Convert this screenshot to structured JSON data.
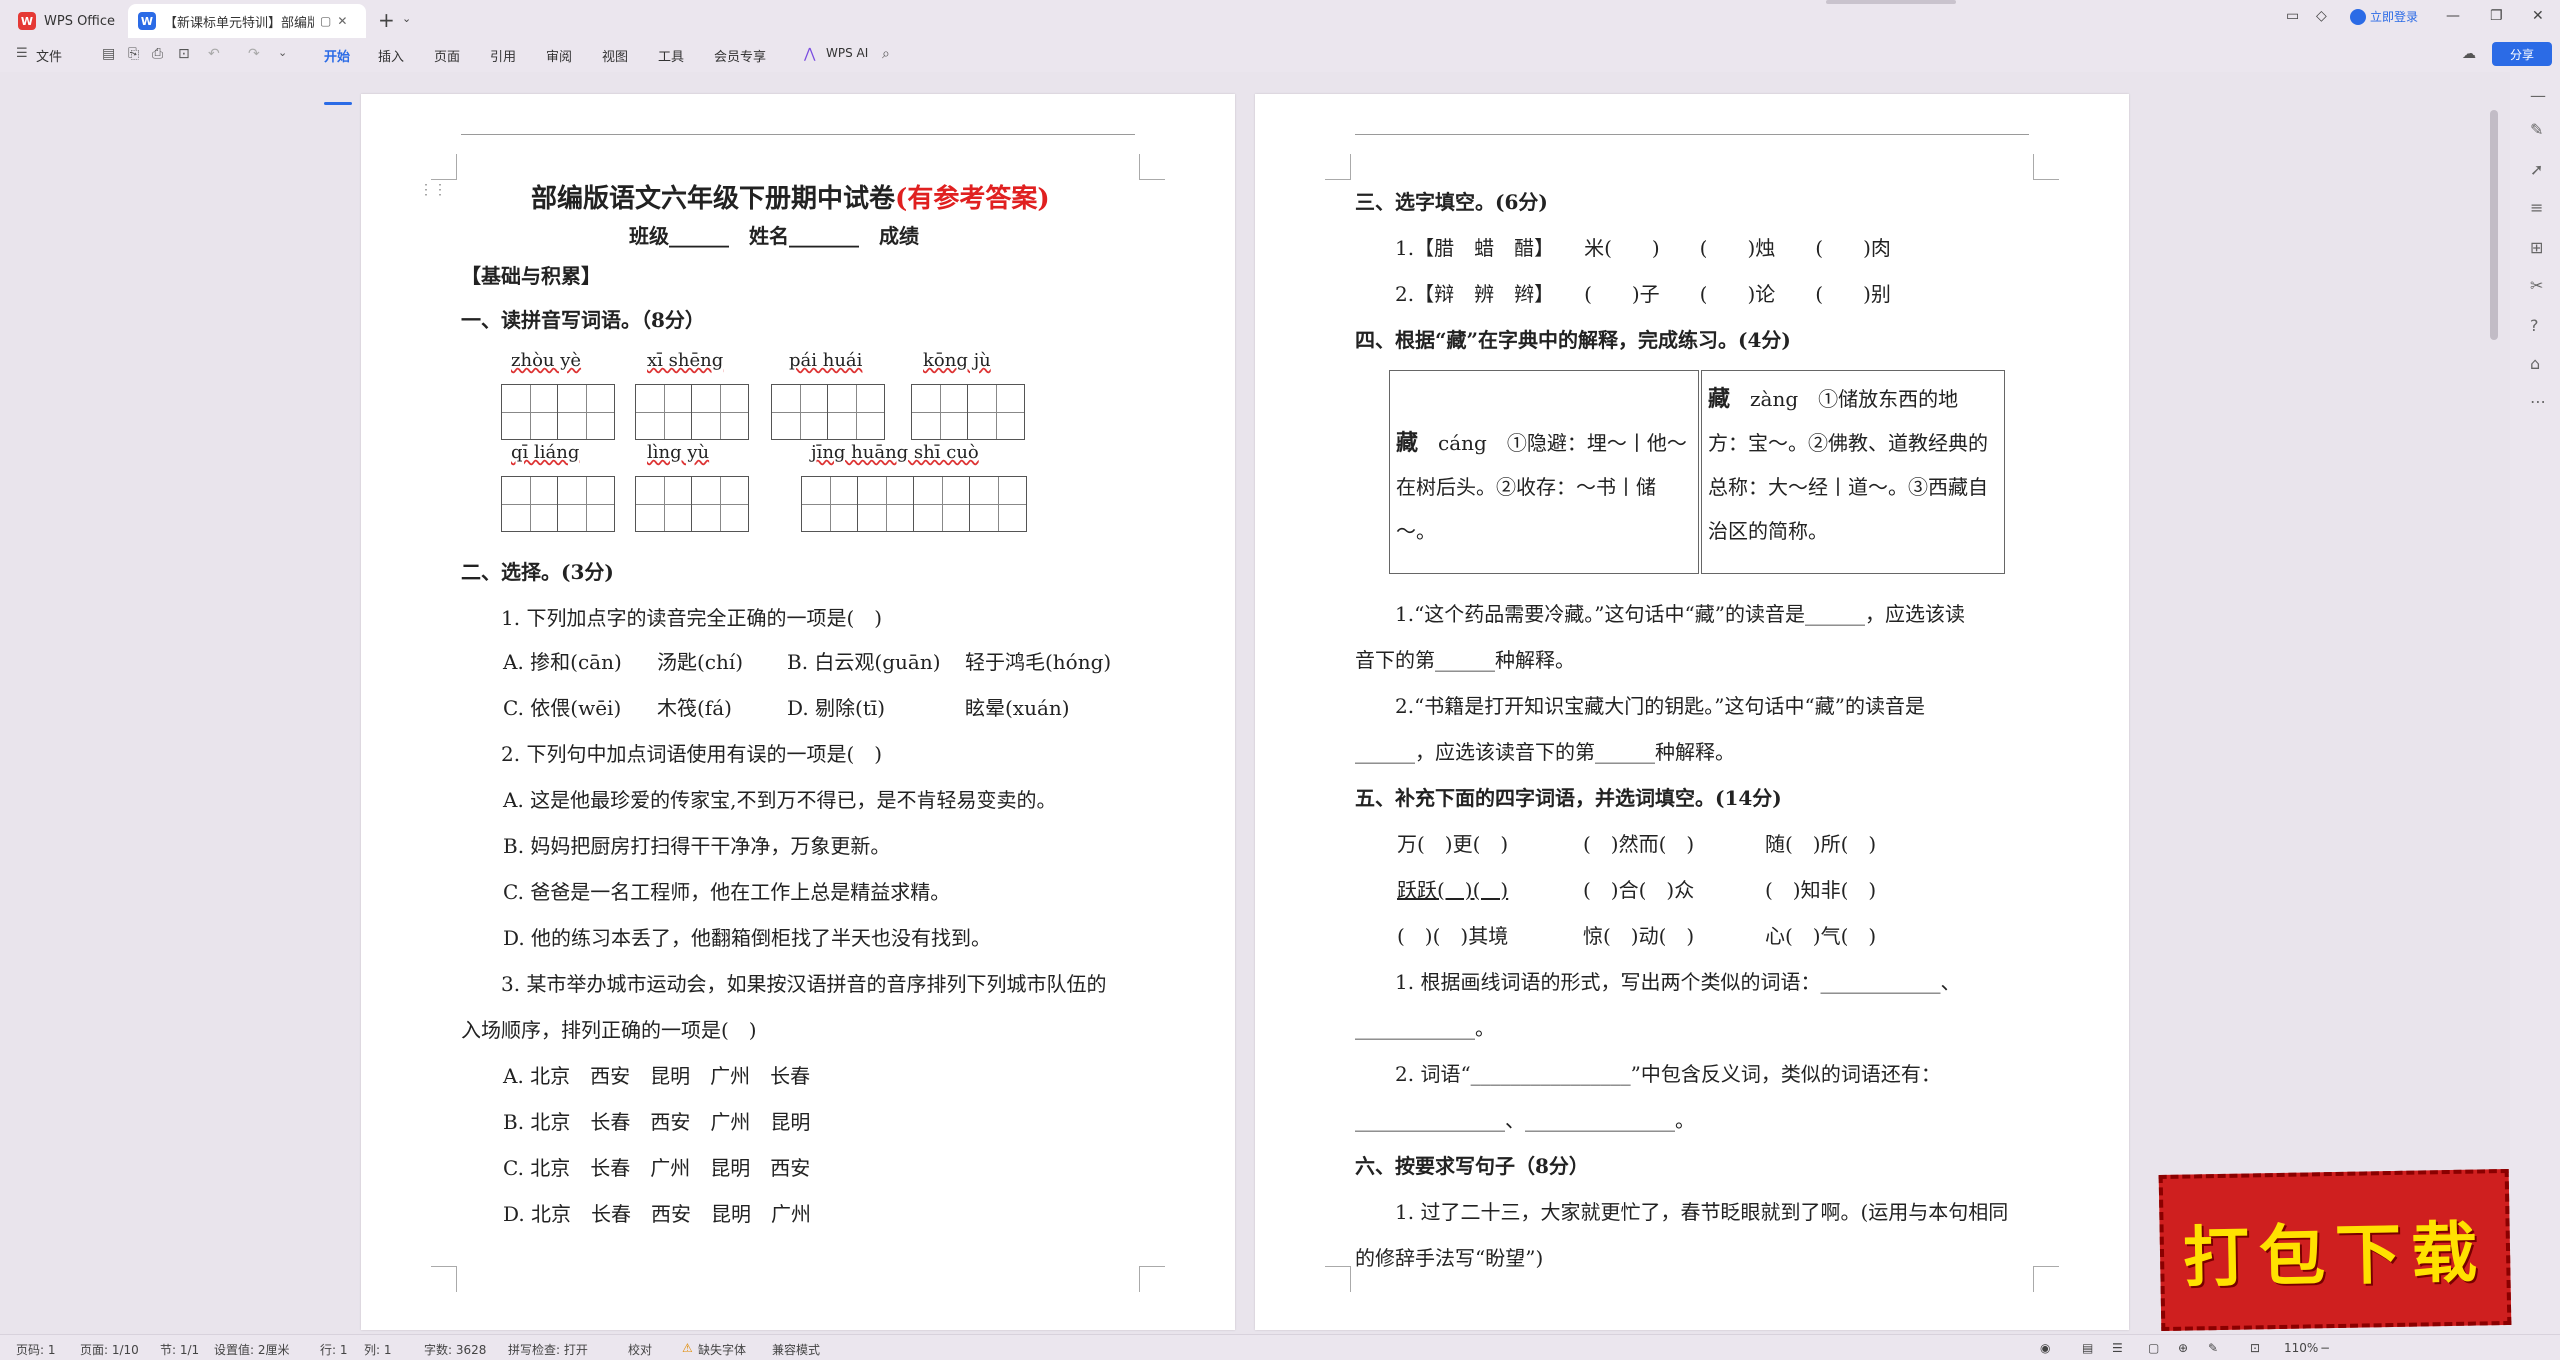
{
  "titlebar": {
    "home_tab": "WPS Office",
    "doc_tab": "【新课标单元特训】部编版语",
    "login": "立即登录",
    "logo_icon": "wps-logo-icon",
    "doc_icon": "writer-doc-icon"
  },
  "ribbon": {
    "file": "文件",
    "tabs": [
      "开始",
      "插入",
      "页面",
      "引用",
      "审阅",
      "视图",
      "工具",
      "会员专享"
    ],
    "ai": "WPS AI",
    "share": "分享",
    "accent": "#2b6be6"
  },
  "page1": {
    "title_main": "部编版语文六年级下册期中试卷",
    "title_suffix": "(有参考答案)",
    "info": "班级______　姓名_______　成绩",
    "section_basic": "【基础与积累】",
    "s1": "一、读拼音写词语。（8分）",
    "pinyin": [
      "zhòu yè",
      "xī shēng",
      "pái huái",
      "kōng jù",
      "qī liáng",
      "lìng yù",
      "jīng huāng shī cuò"
    ],
    "s2": "二、选择。(3分)",
    "q1": "1. 下列加点字的读音完全正确的一项是(　)",
    "q1a1": "A. 掺和(cān)",
    "q1a2": "汤匙(chí)",
    "q1b1": "B. 白云观(guān)",
    "q1b2": "轻于鸿毛(hóng)",
    "q1c1": "C. 依偎(wēi)",
    "q1c2": "木筏(fá)",
    "q1d1": "D. 剔除(tī)",
    "q1d2": "眩晕(xuán)",
    "q2": "2. 下列句中加点词语使用有误的一项是(　)",
    "q2a": "A. 这是他最珍爱的传家宝,不到万不得已，是不肯轻易变卖的。",
    "q2b": "B. 妈妈把厨房打扫得干干净净，万象更新。",
    "q2c": "C. 爸爸是一名工程师，他在工作上总是精益求精。",
    "q2d": "D. 他的练习本丢了，他翻箱倒柜找了半天也没有找到。",
    "q3_line1": "3. 某市举办城市运动会，如果按汉语拼音的音序排列下列城市队伍的",
    "q3_line2": "入场顺序，排列正确的一项是(　)",
    "q3a": "A. 北京　西安　昆明　广州　长春",
    "q3b": "B. 北京　长春　西安　广州　昆明",
    "q3c": "C. 北京　长春　广州　昆明　西安",
    "q3d": "D. 北京　长春　西安　昆明　广州"
  },
  "page2": {
    "s3": "三、选字填空。(6分)",
    "s3_1": "1.【腊　蜡　醋】　　米(　　)　　(　　)烛　　(　　)肉",
    "s3_2": "2.【辩　辨　辫】　　(　　)子　　(　　)论　　(　　)别",
    "s4": "四、根据“藏”在字典中的解释，完成练习。(4分)",
    "box1_head": "藏",
    "box1_py": "　cáng　",
    "box1_body": "①隐避：埋～丨他～在树后头。②收存：～书丨储～。",
    "box2_head": "藏",
    "box2_py": "　zàng　",
    "box2_body": "①储放东西的地方：宝～。②佛教、道教经典的总称：大～经丨道～。③西藏自治区的简称。",
    "s4_1a": "1.“这个药品需要冷藏。”这句话中“藏”的读音是______，应选该读",
    "s4_1b": "音下的第______种解释。",
    "s4_2a": "2.“书籍是打开知识宝藏大门的钥匙。”这句话中“藏”的读音是",
    "s4_2b": "______，应选该读音下的第______种解释。",
    "s5": "五、补充下面的四字词语，并选词填空。(14分)",
    "s5_r1a": "万(　)更(　)",
    "s5_r1b": "(　)然而(　)",
    "s5_r1c": "随(　)所(　)",
    "s5_r2a": "跃跃(　)(　)",
    "s5_r2b": "(　)合(　)众",
    "s5_r2c": "(　)知非(　)",
    "s5_r3a": "(　)(　)其境",
    "s5_r3b": "惊(　)动(　)",
    "s5_r3c": "心(　)气(　)",
    "s5_1a": "1. 根据画线词语的形式，写出两个类似的词语：____________、",
    "s5_1b": "____________。",
    "s5_2a": "2. 词语“________________”中包含反义词，类似的词语还有：",
    "s5_2b": "_______________、_______________。",
    "s6": "六、按要求写句子（8分）",
    "s6_1a": "1. 过了二十三，大家就更忙了，春节眨眼就到了啊。(运用与本句相同",
    "s6_1b": "的修辞手法写“盼望”)"
  },
  "statusbar": {
    "page_no": "页码: 1",
    "pages": "页面: 1/10",
    "section": "节: 1/1",
    "setting": "设置值: 2厘米",
    "row": "行: 1",
    "col": "列: 1",
    "words": "字数: 3628",
    "spell": "拼写检查: 打开",
    "proof": "校对",
    "missing_font": "缺失字体",
    "compat": "兼容模式",
    "zoom": "110%"
  },
  "banner": "打包下载"
}
